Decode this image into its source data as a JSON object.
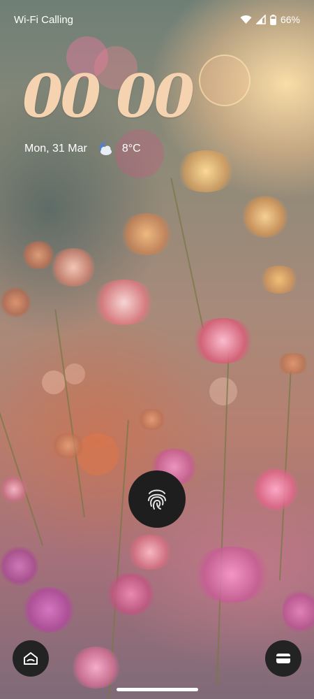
{
  "status_bar": {
    "carrier_text": "Wi-Fi Calling",
    "battery_text": "66%",
    "icons": [
      "wifi-icon",
      "cell-signal-icon",
      "battery-icon"
    ]
  },
  "lockscreen": {
    "time": "00 00",
    "date": "Mon, 31 Mar",
    "weather_icon": "moon-cloud-icon",
    "temperature": "8°C"
  },
  "controls": {
    "fingerprint_icon": "fingerprint-icon",
    "left_shortcut_icon": "home-icon",
    "right_shortcut_icon": "wallet-icon"
  },
  "colors": {
    "clock": "#f6d3b0",
    "button_bg": "#232323"
  }
}
